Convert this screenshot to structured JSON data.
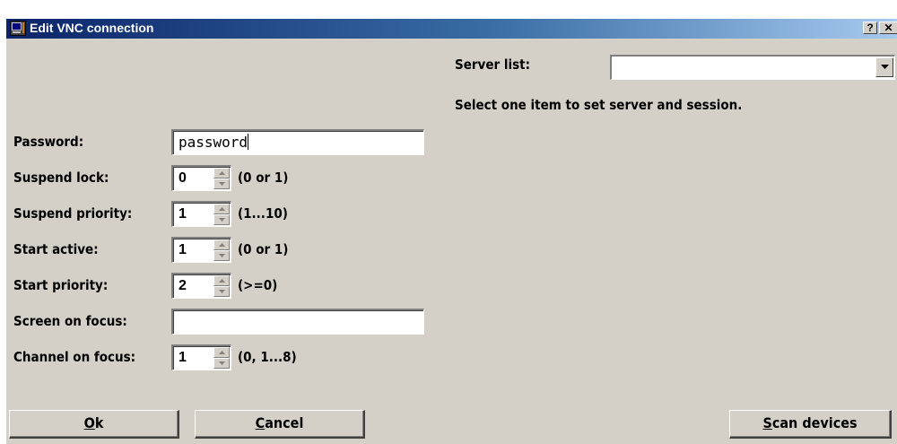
{
  "window": {
    "title": "Edit VNC connection",
    "help_label": "?",
    "close_label": "✕"
  },
  "server_list": {
    "label": "Server list:",
    "value": "",
    "hint": "Select one item to set server and session."
  },
  "password": {
    "label": "Password:",
    "value": "password"
  },
  "suspend_lock": {
    "label": "Suspend lock:",
    "value": "0",
    "range": "(0 or 1)"
  },
  "suspend_priority": {
    "label": "Suspend priority:",
    "value": "1",
    "range": "(1...10)"
  },
  "start_active": {
    "label": "Start active:",
    "value": "1",
    "range": "(0 or 1)"
  },
  "start_priority": {
    "label": "Start priority:",
    "value": "2",
    "range": "(>=0)"
  },
  "screen_on_focus": {
    "label": "Screen on focus:",
    "value": ""
  },
  "channel_on_focus": {
    "label": "Channel on focus:",
    "value": "1",
    "range": "(0, 1...8)"
  },
  "buttons": {
    "ok": {
      "mnemonic": "O",
      "rest": "k"
    },
    "cancel": {
      "mnemonic": "C",
      "rest": "ancel"
    },
    "scan": {
      "mnemonic": "S",
      "rest": "can devices"
    }
  },
  "colors": {
    "face": "#d4d0c8",
    "title_start": "#0a246a",
    "title_end": "#a6caf0"
  }
}
